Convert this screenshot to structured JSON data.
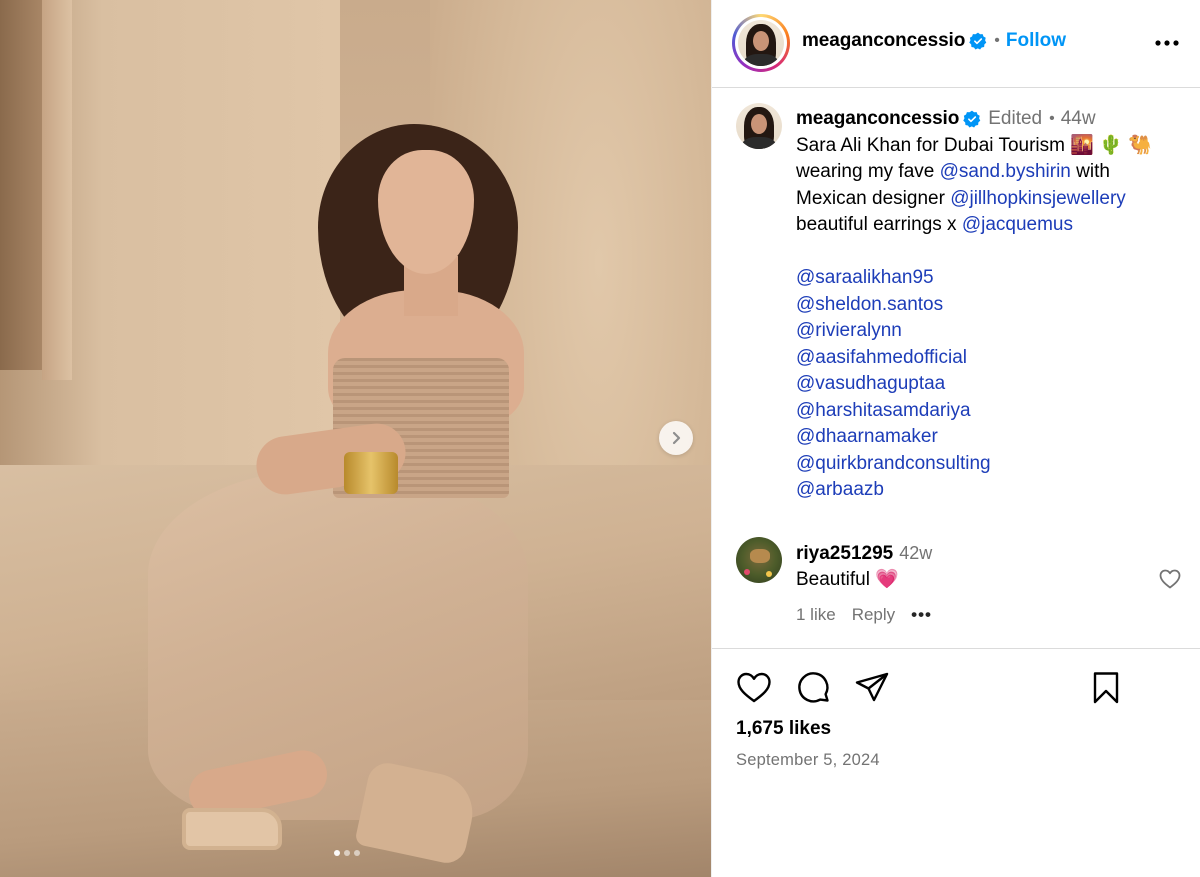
{
  "post": {
    "image_alt": "Woman in a beige strapless dress seated on a sandstone step",
    "carousel": {
      "current": 1,
      "total": 3
    }
  },
  "header": {
    "username": "meaganconcessio",
    "verified": true,
    "separator": "•",
    "follow_label": "Follow"
  },
  "caption": {
    "username": "meaganconcessio",
    "edited_label": "Edited",
    "separator": "•",
    "age": "44w",
    "lines": [
      {
        "text": "Sara Ali Khan for Dubai Tourism 🌇 🌵 🐫"
      },
      {
        "pre": "wearing my fave ",
        "mention": "@sand.byshirin",
        "post": " with"
      },
      {
        "pre": "Mexican designer ",
        "mention": "@jillhopkinsjewellery",
        "post": ""
      },
      {
        "pre": "beautiful earrings x ",
        "mention": "@jacquemus",
        "post": ""
      }
    ],
    "tags": [
      "@saraalikhan95",
      "@sheldon.santos",
      "@rivieralynn",
      "@aasifahmedofficial",
      "@vasudhaguptaa",
      "@harshitasamdariya",
      "@dhaarnamaker",
      "@quirkbrandconsulting",
      "@arbaazb"
    ]
  },
  "comment": {
    "username": "riya251295",
    "age": "42w",
    "text": "Beautiful 💗",
    "likes_label": "1 like",
    "reply_label": "Reply",
    "more_label": "•••"
  },
  "stats": {
    "likes": "1,675 likes",
    "date": "September 5, 2024"
  },
  "colors": {
    "link": "#1d3db8",
    "follow": "#0095f6",
    "meta": "#737373",
    "divider": "#dbdbdb"
  },
  "icons": {
    "verified": "verified-badge-icon",
    "more": "more-horizontal-icon",
    "next": "chevron-right-icon",
    "like": "heart-icon",
    "comment": "comment-bubble-icon",
    "share": "paper-plane-icon",
    "save": "bookmark-icon"
  }
}
